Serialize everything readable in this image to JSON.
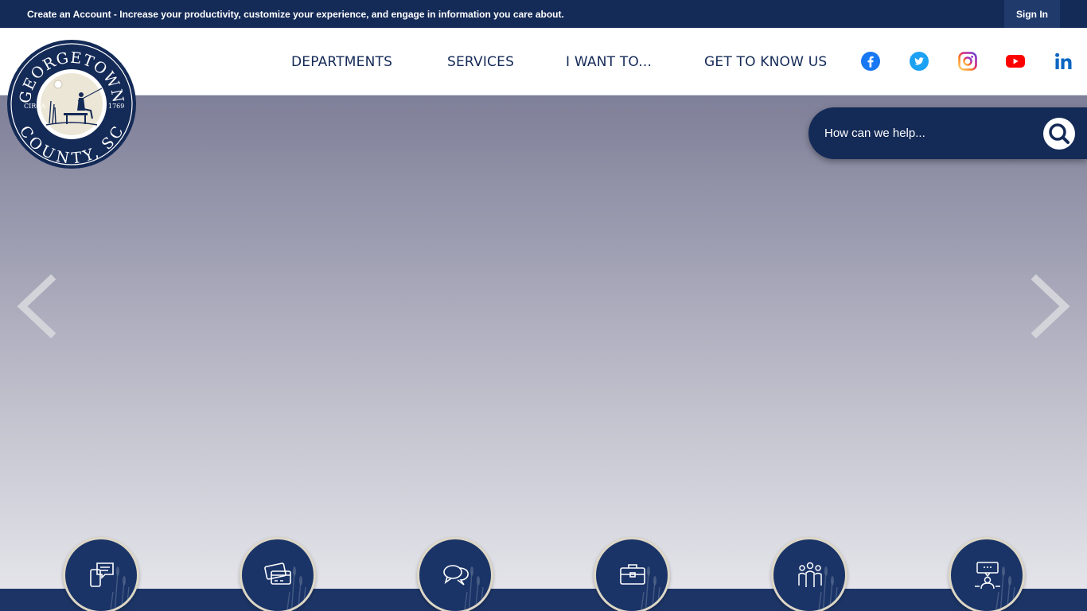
{
  "topbar": {
    "account_link": "Create an Account",
    "message": " - Increase your productivity, customize your experience, and engage in information you care about.",
    "sign_in": "Sign In"
  },
  "logo": {
    "top_text": "GEORGETOWN",
    "bottom_text": "COUNTY, SC",
    "circa": "CIRCA",
    "year": "1769"
  },
  "nav": {
    "items": [
      "DEPARTMENTS",
      "SERVICES",
      "I WANT TO...",
      "GET TO KNOW US"
    ]
  },
  "social": [
    "facebook-icon",
    "twitter-icon",
    "instagram-icon",
    "youtube-icon",
    "linkedin-icon"
  ],
  "search": {
    "placeholder": "How can we help..."
  },
  "quick_links": [
    "chat-phone-icon",
    "credit-card-icon",
    "speech-bubbles-icon",
    "briefcase-icon",
    "people-group-icon",
    "presenter-icon"
  ],
  "colors": {
    "navy": "#142a57",
    "accent_cream": "#ddd7c6"
  }
}
